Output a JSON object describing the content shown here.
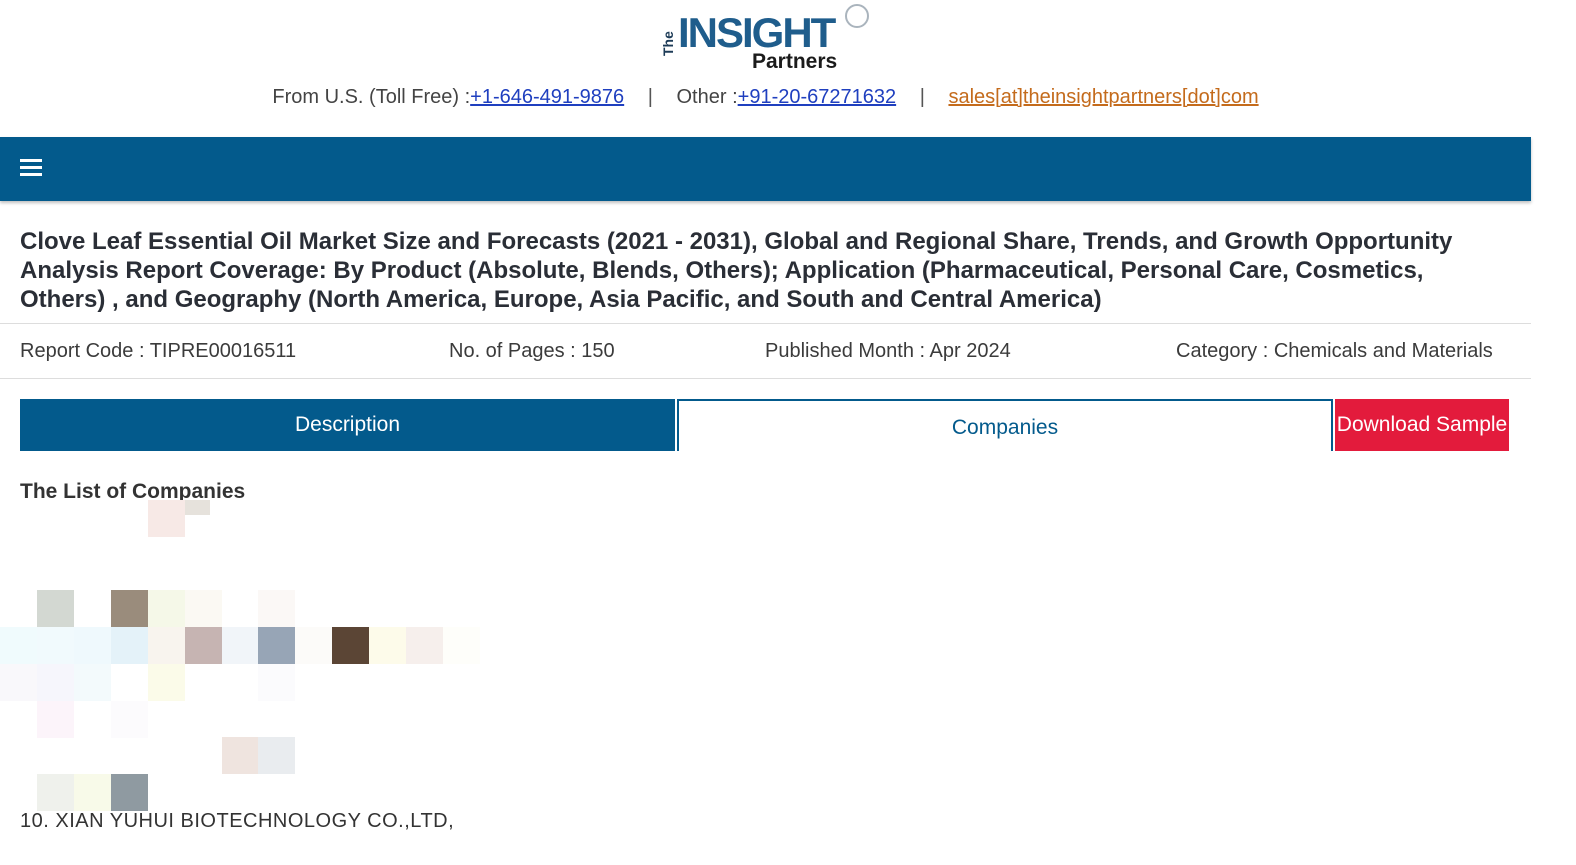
{
  "logo": {
    "the": "The",
    "insight": "INSIGHT",
    "partners": "Partners"
  },
  "contact": {
    "us_label": "From U.S. (Toll Free) :",
    "us_phone": "+1-646-491-9876",
    "separator": "|",
    "other_label": "Other :",
    "other_phone": "+91-20-67271632",
    "email": "sales[at]theinsightpartners[dot]com"
  },
  "navbar": {
    "menu_icon": "hamburger-menu-icon",
    "background": "#035a8c"
  },
  "report": {
    "title": "Clove Leaf Essential Oil Market Size and Forecasts (2021 - 2031), Global and Regional Share, Trends, and Growth Opportunity Analysis Report Coverage: By Product (Absolute, Blends, Others); Application (Pharmaceutical, Personal Care, Cosmetics, Others) , and Geography (North America, Europe, Asia Pacific, and South and Central America)",
    "report_code": "Report Code : TIPRE00016511",
    "pages": "No. of Pages : 150",
    "published": "Published Month : Apr 2024",
    "category": "Category : Chemicals and Materials"
  },
  "tabs": {
    "description": "Description",
    "companies": "Companies",
    "download_sample": "Download Sample"
  },
  "colors": {
    "primary": "#035a8c",
    "accent_red": "#e31b3c",
    "email_link": "#c46b1c"
  },
  "companies": {
    "heading": "The List of Companies",
    "visible_item": "10. XIAN YUHUI BIOTECHNOLOGY CO.,LTD,"
  }
}
